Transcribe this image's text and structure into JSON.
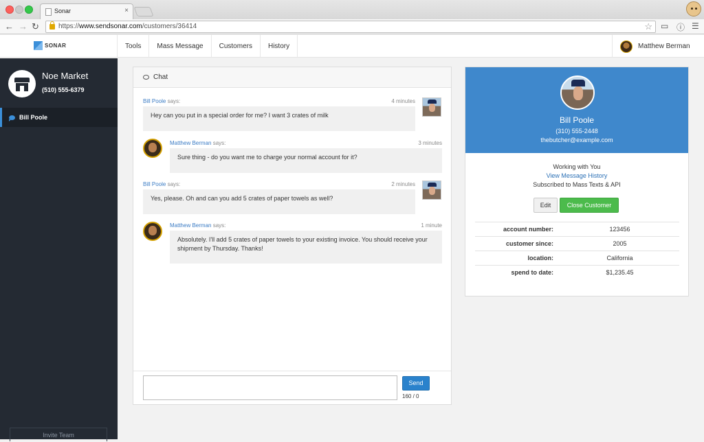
{
  "browser": {
    "tab_title": "Sonar",
    "tab_close": "×",
    "url_prefix": "https://",
    "url_host": "www.sendsonar.com",
    "url_path": "/customers/36414"
  },
  "nav": {
    "brand": "SONAR",
    "items": [
      "Tools",
      "Mass Message",
      "Customers",
      "History"
    ],
    "user_name": "Matthew Berman"
  },
  "sidebar": {
    "store_name": "Noe Market",
    "store_phone": "(510) 555-6379",
    "active_item": "Bill Poole",
    "invite_label": "Invite Team"
  },
  "chat": {
    "title": "Chat",
    "messages": [
      {
        "sender": "Bill Poole",
        "says": "says:",
        "time": "4 minutes",
        "text": "Hey can you put in a special order for me? I want 3 crates of milk"
      },
      {
        "sender": "Matthew Berman",
        "says": "says:",
        "time": "3 minutes",
        "text": "Sure thing - do you want me to charge your normal account for it?"
      },
      {
        "sender": "Bill Poole",
        "says": "says:",
        "time": "2 minutes",
        "text": "Yes, please. Oh and can you add 5 crates of paper towels as well?"
      },
      {
        "sender": "Matthew Berman",
        "says": "says:",
        "time": "1 minute",
        "text": "Absolutely. I'll add 5 crates of paper towels to your existing invoice. You should receive your shipment by Thursday. Thanks!"
      }
    ],
    "input_value": "",
    "send_label": "Send",
    "char_count": "160 / 0"
  },
  "customer": {
    "name": "Bill Poole",
    "phone": "(310) 555-2448",
    "email": "thebutcher@example.com",
    "working_with": "Working with You",
    "history_link": "View Message History",
    "subscription": "Subscribed to Mass Texts & API",
    "edit_label": "Edit",
    "close_label": "Close Customer",
    "details": [
      {
        "label": "account number:",
        "value": "123456"
      },
      {
        "label": "customer since:",
        "value": "2005"
      },
      {
        "label": "location:",
        "value": "California"
      },
      {
        "label": "spend to date:",
        "value": "$1,235.45"
      }
    ]
  },
  "colors": {
    "accent": "#3f88cc",
    "sidebar_bg": "#242a33",
    "success": "#4cbb4c",
    "link": "#3a7bc4"
  }
}
